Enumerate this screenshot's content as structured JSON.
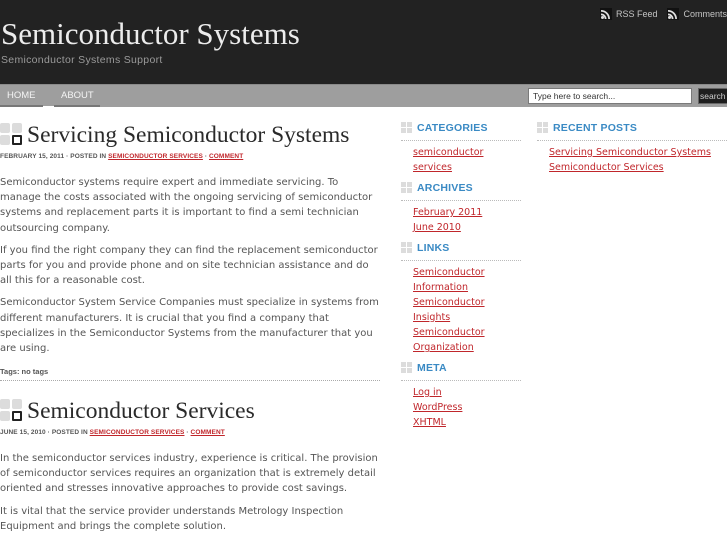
{
  "header": {
    "site_title": "Semiconductor Systems",
    "site_description": "Semiconductor Systems Support",
    "feeds": [
      {
        "label": "RSS Feed",
        "icon": "rss-icon"
      },
      {
        "label": "Comments",
        "icon": "rss-icon"
      }
    ]
  },
  "nav": {
    "items": [
      {
        "label": "HOME"
      },
      {
        "label": "ABOUT"
      }
    ],
    "search": {
      "placeholder": "Type here to search...",
      "value": "Type here to search...",
      "button_label": "search"
    }
  },
  "posts": [
    {
      "title": "Servicing Semiconductor Systems",
      "date": "FEBRUARY 15, 2011",
      "posted_in_label": "POSTED IN",
      "category": "SEMICONDUCTOR SERVICES",
      "comment_label": "COMMENT",
      "separator": "·",
      "paragraphs": [
        "Semiconductor systems require expert and immediate servicing.  To manage the costs associated with the ongoing servicing of semiconductor systems and replacement parts it is important to find a semi technician outsourcing company.",
        "If you find the right company they can find the replacement semiconductor parts for you and provide phone and on site technician assistance and do all this for a reasonable cost.",
        "Semiconductor System Service Companies must specialize in systems from different manufacturers.  It is crucial that you find  a company that specializes in the Semiconductor Systems from the manufacturer that you are using."
      ],
      "tags": "Tags: no tags"
    },
    {
      "title": "Semiconductor Services",
      "date": "JUNE 15, 2010",
      "posted_in_label": "POSTED IN",
      "category": "SEMICONDUCTOR SERVICES",
      "comment_label": "COMMENT",
      "separator": "·",
      "paragraphs": [
        "In the semiconductor services industry, experience is critical.   The provision of semiconductor services requires an organization that is extremely detail oriented  and stresses innovative approaches to provide cost savings.",
        "It is vital that the service provider understands Metrology Inspection Equipment and brings the complete solution."
      ]
    }
  ],
  "sidebar": {
    "categories": {
      "title": "CATEGORIES",
      "items": [
        "semiconductor services"
      ]
    },
    "archives": {
      "title": "ARCHIVES",
      "items": [
        "February 2011",
        "June 2010"
      ]
    },
    "links": {
      "title": "LINKS",
      "items": [
        "Semiconductor Information",
        "Semiconductor Insights",
        "Semiconductor Organization"
      ]
    },
    "meta": {
      "title": "META",
      "items": [
        "Log in",
        "WordPress",
        "XHTML"
      ]
    },
    "recent_posts": {
      "title": "RECENT POSTS",
      "items": [
        "Servicing Semiconductor Systems",
        "Semiconductor Services"
      ]
    }
  },
  "colors": {
    "header_bg": "#222222",
    "nav_bg": "#9e9e9e",
    "link": "#c0262b",
    "widget_title": "#3a8ac4"
  }
}
